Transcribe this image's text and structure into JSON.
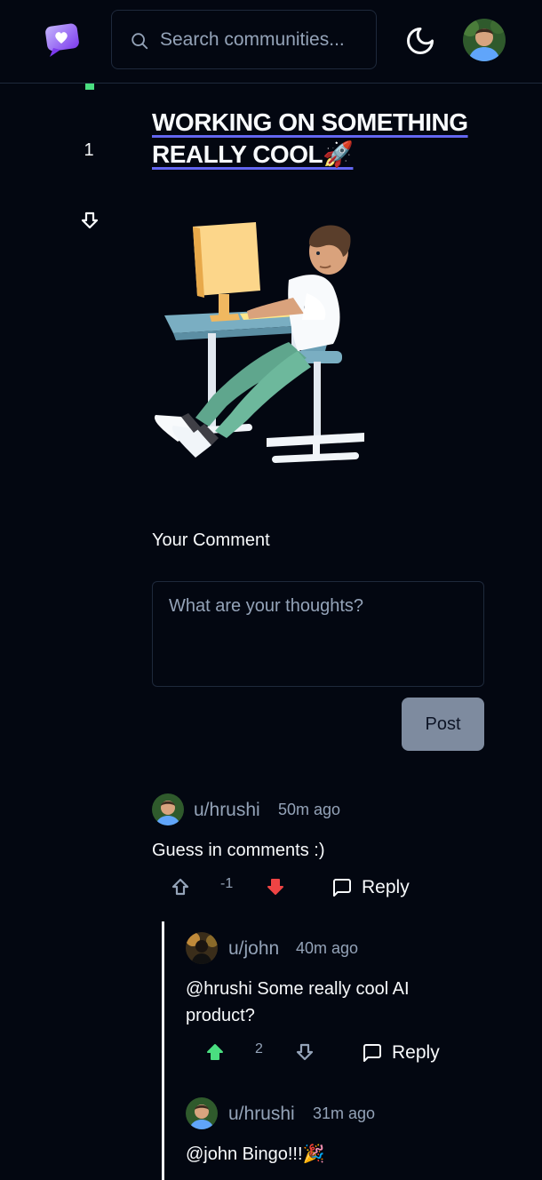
{
  "header": {
    "search": {
      "placeholder": "Search communities..."
    }
  },
  "post": {
    "votes": "1",
    "title": "WORKING ON SOMETHING REALLY COOL🚀",
    "image_alt_icon": "person-at-desk-illustration"
  },
  "comment_form": {
    "label": "Your Comment",
    "placeholder": "What are your thoughts?",
    "submit_label": "Post"
  },
  "comments": [
    {
      "user": "u/hrushi",
      "time": "50m ago",
      "text": "Guess in comments :)",
      "votes": "-1",
      "vote_state": "down",
      "reply_label": "Reply"
    },
    {
      "user": "u/john",
      "time": "40m ago",
      "text": "@hrushi Some really cool AI product?",
      "votes": "2",
      "vote_state": "up",
      "reply_label": "Reply"
    },
    {
      "user": "u/hrushi",
      "time": "31m ago",
      "text": "@john Bingo!!!🎉"
    }
  ],
  "colors": {
    "background": "#030711",
    "accent_underline": "#6366f1",
    "upvote": "#4ade80",
    "downvote": "#ef4444",
    "muted": "#94a3b8"
  }
}
